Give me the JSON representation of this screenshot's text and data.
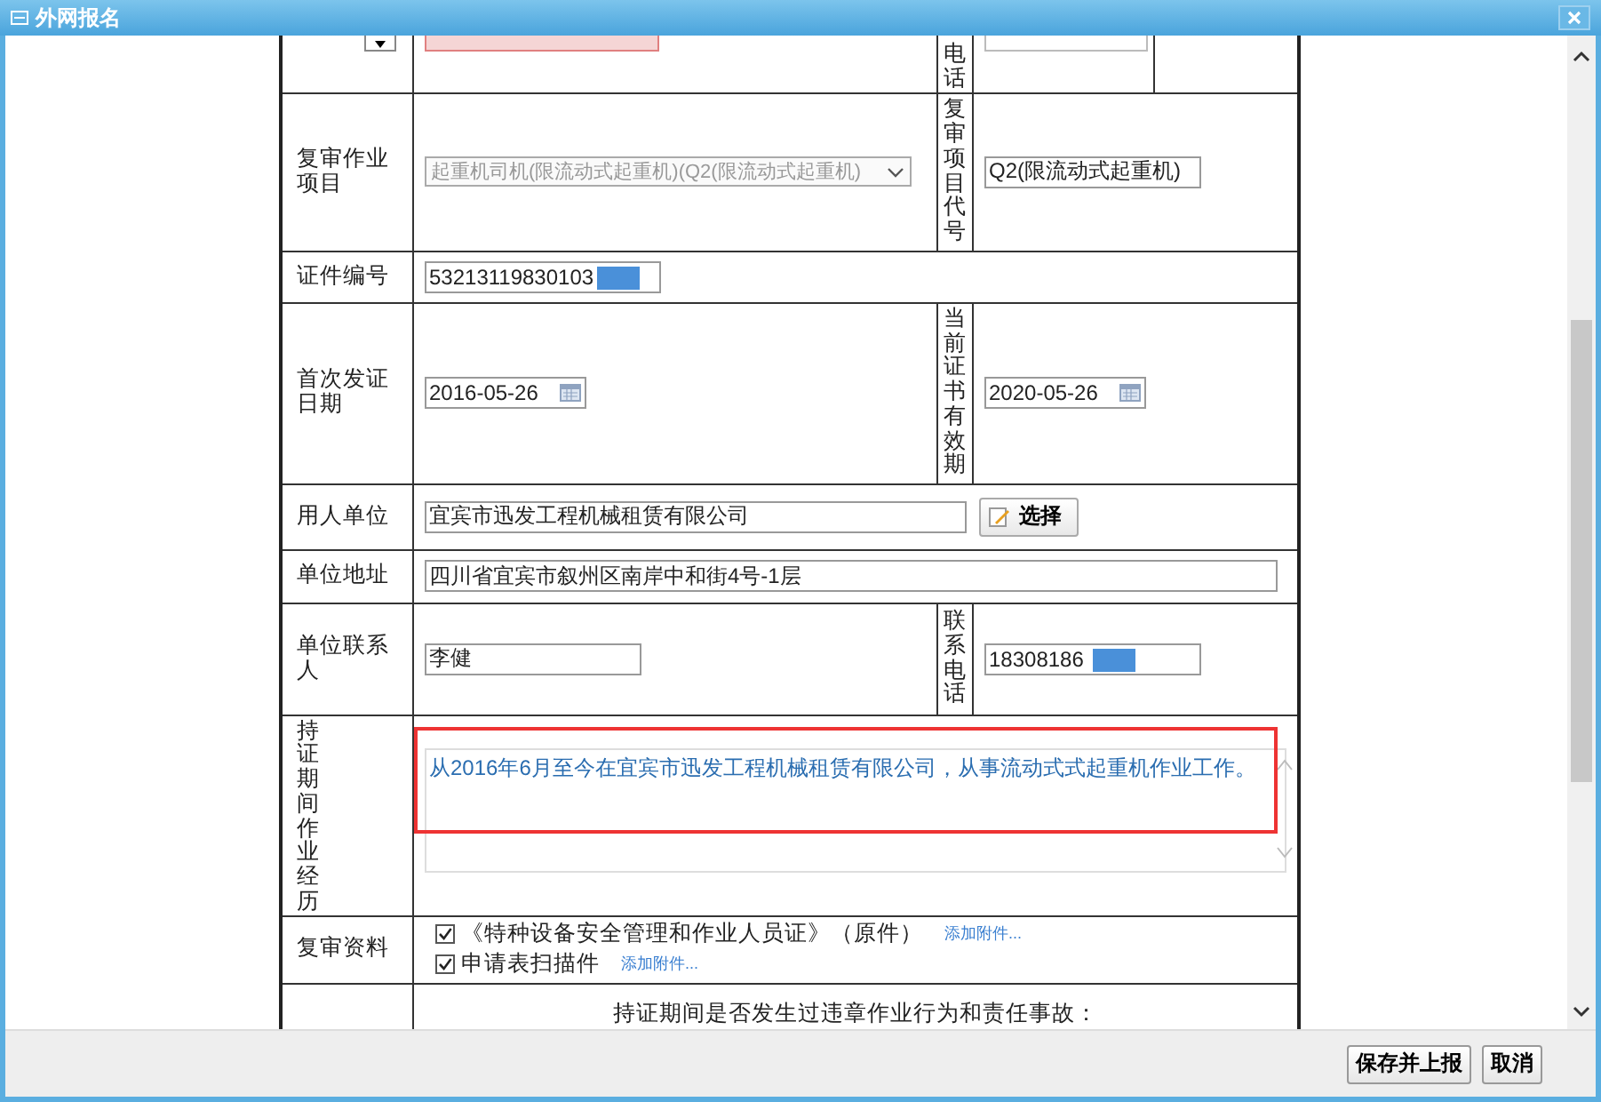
{
  "window": {
    "title": "外网报名"
  },
  "id_row": {
    "phone_label": "电话"
  },
  "review_item": {
    "label": "复审作业项目",
    "value": "起重机司机(限流动式起重机)(Q2(限流动式起重机)",
    "disabled": true,
    "code_label": "复审项目代号",
    "code_value": "Q2(限流动式起重机)"
  },
  "cert_no": {
    "label": "证件编号",
    "value": "53213119830103"
  },
  "dates": {
    "first_label": "首次发证日期",
    "first_value": "2016-05-26",
    "valid_label": "当前证书有效期",
    "valid_value": "2020-05-26"
  },
  "employer": {
    "label": "用人单位",
    "value": "宜宾市迅发工程机械租赁有限公司",
    "button": "选择"
  },
  "address": {
    "label": "单位地址",
    "value": "四川省宜宾市叙州区南岸中和街4号-1层"
  },
  "contact": {
    "label": "单位联系人",
    "value": "李健",
    "phone_label": "联系电话",
    "phone": "18308186"
  },
  "experience": {
    "label": "持证期间作业经历",
    "value": "从2016年6月至今在宜宾市迅发工程机械租赁有限公司，从事流动式式起重机作业工作。",
    "highlighted": true
  },
  "materials": {
    "label": "复审资料",
    "items": [
      {
        "label": "《特种设备安全管理和作业人员证》（原件）",
        "checked": true,
        "link": "添加附件..."
      },
      {
        "label": "申请表扫描件",
        "checked": true,
        "link": "添加附件..."
      }
    ]
  },
  "violation": {
    "question": "持证期间是否发生过违章作业行为和责任事故："
  },
  "buttons": [
    {
      "label": "保存并上报"
    },
    {
      "label": "取消"
    }
  ]
}
